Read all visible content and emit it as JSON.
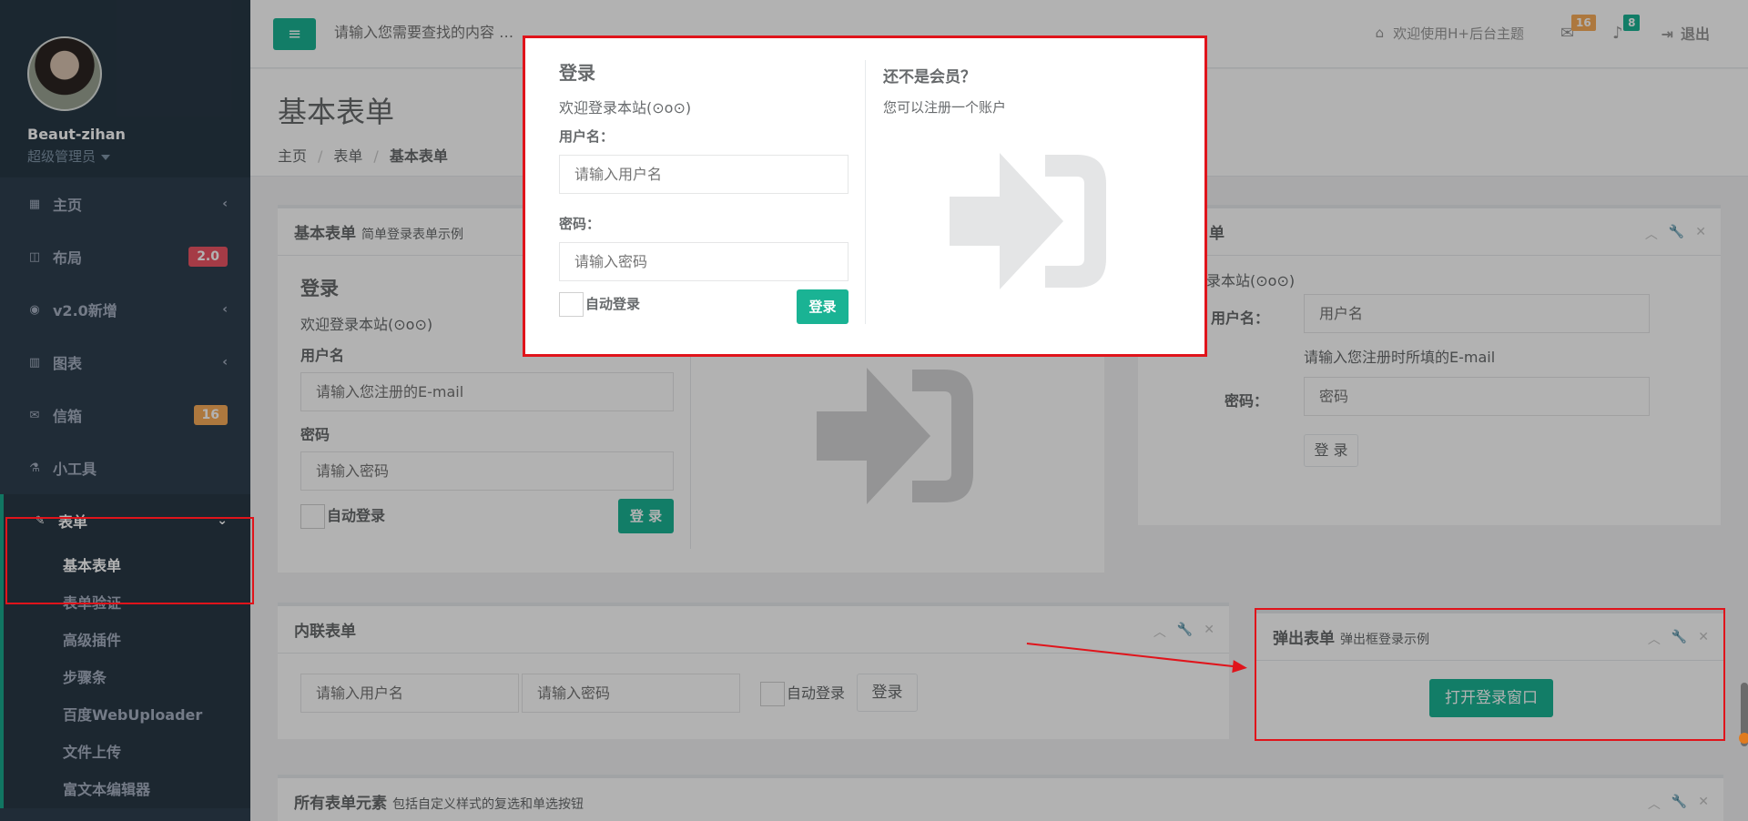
{
  "sidebar": {
    "user_name": "Beaut-zihan",
    "user_role": "超级管理员",
    "items": [
      {
        "label": "主页",
        "icon": "grid-icon"
      },
      {
        "label": "布局",
        "icon": "columns-icon",
        "badge": "2.0"
      },
      {
        "label": "v2.0新增",
        "icon": "globe-icon"
      },
      {
        "label": "图表",
        "icon": "bar-chart-icon"
      },
      {
        "label": "信箱",
        "icon": "envelope-icon",
        "badge": "16"
      },
      {
        "label": "小工具",
        "icon": "flask-icon"
      },
      {
        "label": "表单",
        "icon": "edit-icon"
      }
    ],
    "subitems": [
      "基本表单",
      "表单验证",
      "高级插件",
      "步骤条",
      "百度WebUploader",
      "文件上传",
      "富文本编辑器"
    ]
  },
  "topbar": {
    "search_placeholder": "请输入您需要查找的内容 …",
    "welcome": "欢迎使用H+后台主题",
    "mail_count": "16",
    "bell_count": "8",
    "logout": "退出"
  },
  "page": {
    "title": "基本表单",
    "breadcrumb": [
      "主页",
      "表单",
      "基本表单"
    ]
  },
  "panel_basic": {
    "title": "基本表单",
    "subtitle": "简单登录表单示例",
    "heading": "登录",
    "welcome": "欢迎登录本站(⊙o⊙)",
    "username_label": "用户名",
    "username_placeholder": "请输入您注册的E-mail",
    "password_label": "密码",
    "password_placeholder": "请输入密码",
    "remember": "自动登录",
    "login_button": "登 录"
  },
  "panel_horizontal": {
    "title": "单",
    "welcome": "录本站(⊙o⊙)",
    "username_label": "用户名：",
    "username_placeholder": "用户名",
    "help": "请输入您注册时所填的E-mail",
    "password_label": "密码：",
    "password_placeholder": "密码",
    "login_button": "登 录"
  },
  "panel_inline": {
    "title": "内联表单",
    "username_placeholder": "请输入用户名",
    "password_placeholder": "请输入密码",
    "remember": "自动登录",
    "login_button": "登录"
  },
  "panel_popup": {
    "title": "弹出表单",
    "subtitle": "弹出框登录示例",
    "open_button": "打开登录窗口"
  },
  "panel_all": {
    "title": "所有表单元素",
    "subtitle": "包括自定义样式的复选和单选按钮"
  },
  "modal": {
    "heading": "登录",
    "welcome": "欢迎登录本站(⊙o⊙)",
    "username_label": "用户名：",
    "username_placeholder": "请输入用户名",
    "password_label": "密码：",
    "password_placeholder": "请输入密码",
    "remember": "自动登录",
    "login_button": "登录",
    "right_heading": "还不是会员？",
    "right_text": "您可以注册一个账户"
  },
  "colors": {
    "accent": "#1ab394",
    "sidebar": "#2f4050",
    "highlight_border": "#e0141b"
  }
}
